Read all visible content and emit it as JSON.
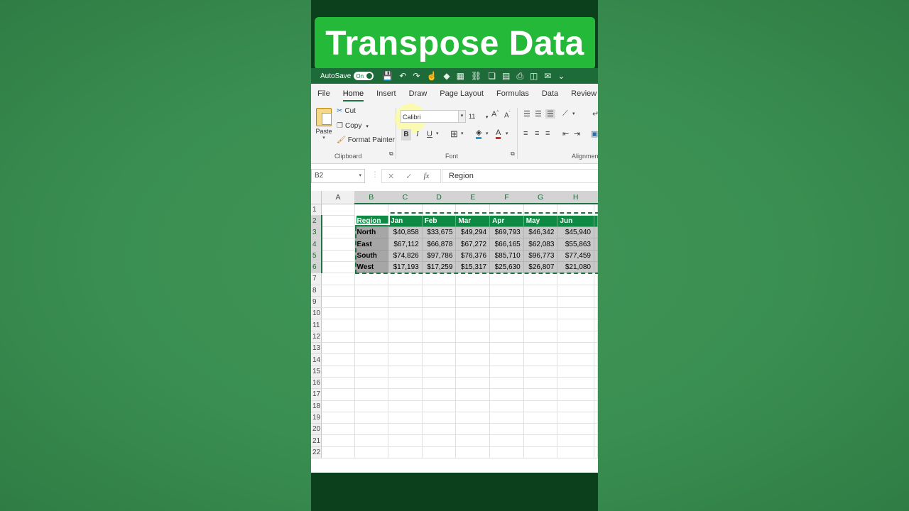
{
  "banner": {
    "title": "Transpose Data"
  },
  "qat": {
    "autosave_label": "AutoSave",
    "autosave_state": "On",
    "icons": [
      "save-icon",
      "undo-icon",
      "redo-icon",
      "touch-mode-icon",
      "paint-icon",
      "table-icon",
      "link-icon",
      "copy-format-icon",
      "print-preview-icon",
      "print-icon",
      "chart-icon",
      "email-icon",
      "customize-icon"
    ]
  },
  "tabs": [
    "File",
    "Home",
    "Insert",
    "Draw",
    "Page Layout",
    "Formulas",
    "Data",
    "Review"
  ],
  "active_tab": "Home",
  "ribbon": {
    "clipboard": {
      "paste": "Paste",
      "cut": "Cut",
      "copy": "Copy",
      "format_painter": "Format Painter",
      "label": "Clipboard"
    },
    "font": {
      "name": "Calibri",
      "size": "11",
      "label": "Font",
      "bold": "B",
      "italic": "I",
      "underline": "U"
    },
    "alignment": {
      "label": "Alignmen"
    }
  },
  "formula_bar": {
    "name_box": "B2",
    "fx": "fx",
    "formula": "Region"
  },
  "sheet": {
    "columns": [
      "A",
      "B",
      "C",
      "D",
      "E",
      "F",
      "G",
      "H"
    ],
    "selected_columns": [
      "B",
      "C",
      "D",
      "E",
      "F",
      "G",
      "H"
    ],
    "rows": [
      "1",
      "2",
      "3",
      "4",
      "5",
      "6",
      "7",
      "8",
      "9",
      "10",
      "11",
      "12",
      "13",
      "14",
      "15",
      "16",
      "17",
      "18",
      "19",
      "20",
      "21",
      "22"
    ],
    "selected_rows": [
      "2",
      "3",
      "4",
      "5",
      "6"
    ],
    "header_row": [
      "Region",
      "Jan",
      "Feb",
      "Mar",
      "Apr",
      "May",
      "Jun"
    ],
    "data": [
      {
        "region": "North",
        "values": [
          "$40,858",
          "$33,675",
          "$49,294",
          "$69,793",
          "$46,342",
          "$45,940"
        ]
      },
      {
        "region": "East",
        "values": [
          "$67,112",
          "$66,878",
          "$67,272",
          "$66,165",
          "$62,083",
          "$55,863"
        ]
      },
      {
        "region": "South",
        "values": [
          "$74,826",
          "$97,786",
          "$76,376",
          "$85,710",
          "$96,773",
          "$77,459"
        ]
      },
      {
        "region": "West",
        "values": [
          "$17,193",
          "$17,259",
          "$15,317",
          "$25,630",
          "$26,807",
          "$21,080"
        ]
      }
    ]
  },
  "colors": {
    "header_fill": "#0f8a45",
    "banner": "#25b93a",
    "excel_green": "#1e6b3a"
  }
}
